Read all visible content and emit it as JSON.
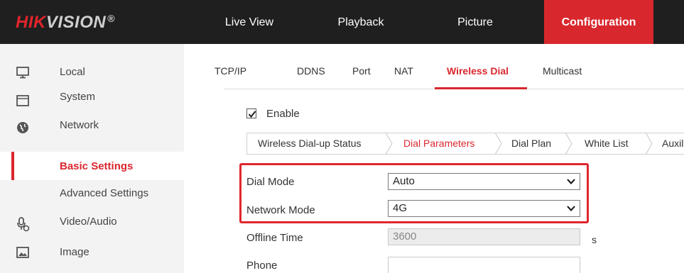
{
  "brand": {
    "name_red": "HIK",
    "name_grey": "VISION",
    "reg_mark": "®"
  },
  "nav": {
    "items": [
      {
        "label": "Live View"
      },
      {
        "label": "Playback"
      },
      {
        "label": "Picture"
      },
      {
        "label": "Configuration",
        "active": true
      }
    ]
  },
  "sidebar": {
    "items": [
      {
        "label": "Local",
        "icon": "monitor-icon"
      },
      {
        "label": "System",
        "icon": "system-icon"
      },
      {
        "label": "Network",
        "icon": "globe-icon"
      },
      {
        "label": "Basic Settings",
        "active": true
      },
      {
        "label": "Advanced Settings"
      },
      {
        "label": "Video/Audio",
        "icon": "microphone-icon"
      },
      {
        "label": "Image",
        "icon": "image-icon"
      }
    ]
  },
  "tabs": {
    "items": [
      {
        "label": "TCP/IP"
      },
      {
        "label": "DDNS"
      },
      {
        "label": "Port"
      },
      {
        "label": "NAT"
      },
      {
        "label": "Wireless Dial",
        "active": true
      },
      {
        "label": "Multicast"
      }
    ]
  },
  "enable": {
    "label": "Enable",
    "checked": true
  },
  "subtabs": {
    "items": [
      {
        "label": "Wireless Dial-up Status"
      },
      {
        "label": "Dial Parameters",
        "active": true
      },
      {
        "label": "Dial Plan"
      },
      {
        "label": "White List"
      },
      {
        "label": "Auxil"
      }
    ]
  },
  "form": {
    "dial_mode": {
      "label": "Dial Mode",
      "value": "Auto"
    },
    "network_mode": {
      "label": "Network Mode",
      "value": "4G"
    },
    "offline_time": {
      "label": "Offline Time",
      "value": "3600",
      "unit": "s"
    },
    "phone": {
      "label": "Phone",
      "value": ""
    }
  },
  "colors": {
    "accent": "#d9272e",
    "topbar": "#1f1f1f",
    "sidebar": "#f3f3f3",
    "highlight_box": "#e0262c"
  }
}
